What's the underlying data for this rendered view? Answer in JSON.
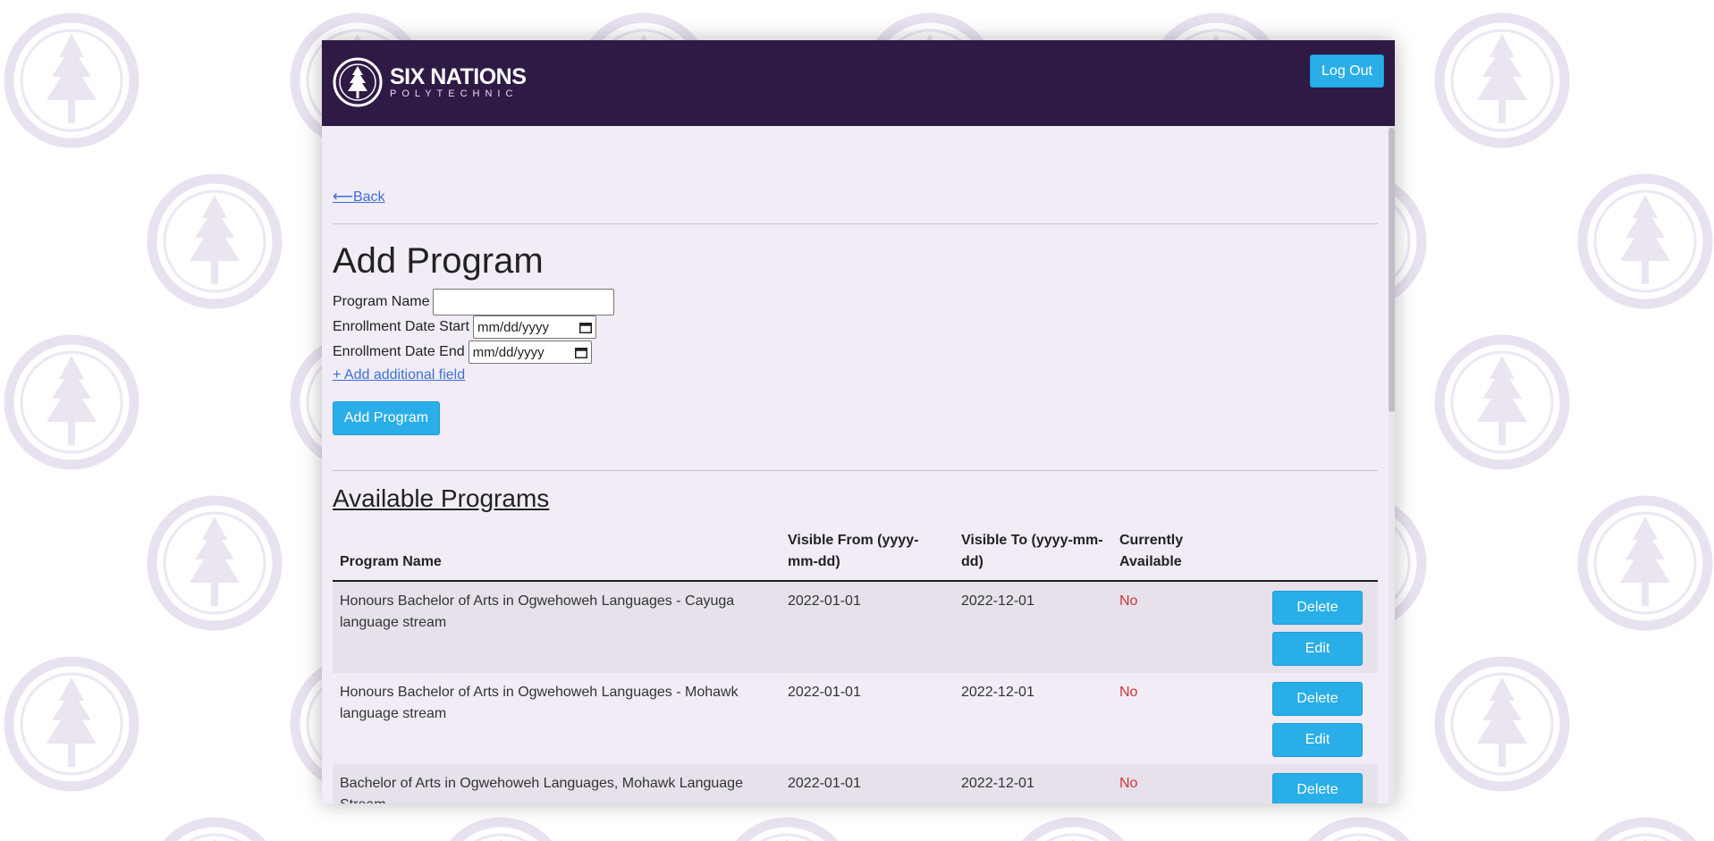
{
  "header": {
    "logo_main": "SIX NATIONS",
    "logo_sub": "POLYTECHNIC",
    "logout_label": "Log Out"
  },
  "nav": {
    "back_label": "⟵Back"
  },
  "form": {
    "title": "Add Program",
    "program_name_label": "Program Name",
    "program_name_value": "",
    "start_label": "Enrollment Date Start",
    "start_value": "mm/dd/yyyy",
    "end_label": "Enrollment Date End",
    "end_value": "mm/dd/yyyy",
    "add_field_label": "+ Add additional field",
    "submit_label": "Add Program"
  },
  "programs": {
    "title": "Available Programs",
    "columns": [
      "Program Name",
      "Visible From (yyyy-mm-dd)",
      "Visible To (yyyy-mm-dd)",
      "Currently Available",
      ""
    ],
    "rows": [
      {
        "name": "Honours Bachelor of Arts in Ogwehoweh Languages - Cayuga language stream",
        "from": "2022-01-01",
        "to": "2022-12-01",
        "available": "No"
      },
      {
        "name": "Honours Bachelor of Arts in Ogwehoweh Languages - Mohawk language stream",
        "from": "2022-01-01",
        "to": "2022-12-01",
        "available": "No"
      },
      {
        "name": "Bachelor of Arts in Ogwehoweh Languages, Mohawk Language Stream",
        "from": "2022-01-01",
        "to": "2022-12-01",
        "available": "No"
      }
    ],
    "delete_label": "Delete",
    "edit_label": "Edit"
  },
  "colors": {
    "header_bg": "#2f1a45",
    "panel_bg": "#f1ecf6",
    "accent_button": "#29aee8",
    "link": "#3d6fd8",
    "status_no": "#d0353a"
  },
  "icons": [
    "tree-seal-logo-icon",
    "calendar-icon"
  ]
}
